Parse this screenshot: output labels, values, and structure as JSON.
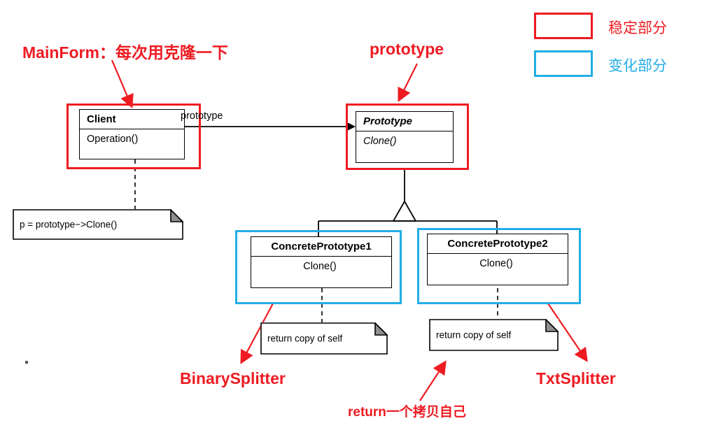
{
  "diagram": {
    "title_note": "Prototype pattern UML class diagram with Chinese annotations",
    "classes": [
      {
        "id": "client",
        "name": "Client",
        "operations": [
          "Operation()"
        ]
      },
      {
        "id": "prototype",
        "name": "Prototype",
        "operations": [
          "Clone()"
        ]
      },
      {
        "id": "concrete1",
        "name": "ConcretePrototype1",
        "operations": [
          "Clone()"
        ]
      },
      {
        "id": "concrete2",
        "name": "ConcretePrototype2",
        "operations": [
          "Clone()"
        ]
      }
    ],
    "association_label": "prototype",
    "notes": [
      {
        "id": "note-client",
        "text": "p = prototype−>Clone()"
      },
      {
        "id": "note-c1",
        "text": "return copy of self"
      },
      {
        "id": "note-c2",
        "text": "return copy of self"
      }
    ],
    "annotations": [
      {
        "id": "anno-mainform",
        "text": "MainForm：每次用克隆一下",
        "color": "#ee1b22"
      },
      {
        "id": "anno-prototype",
        "text": "prototype",
        "color": "#ee1b22"
      },
      {
        "id": "anno-binarysplitter",
        "text": "BinarySplitter",
        "color": "#ee1b22"
      },
      {
        "id": "anno-txtsplitter",
        "text": "TxtSplitter",
        "color": "#ee1b22"
      },
      {
        "id": "anno-return",
        "text": "return一个拷贝自己",
        "color": "#ee1b22"
      }
    ],
    "legend": [
      {
        "id": "legend-stable",
        "label": "稳定部分",
        "color": "#ee1b22"
      },
      {
        "id": "legend-changing",
        "label": "变化部分",
        "color": "#22aee6"
      }
    ]
  }
}
